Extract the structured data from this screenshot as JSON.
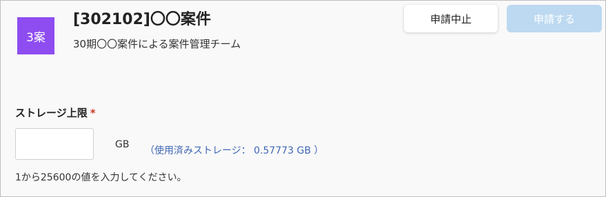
{
  "header": {
    "avatar_text": "3案",
    "avatar_color": "#8e4df0",
    "title": "[302102]〇〇案件",
    "subtitle": "30期〇〇案件による案件管理チーム"
  },
  "actions": {
    "cancel_label": "申請中止",
    "apply_label": "申請する",
    "apply_color": "#bdd9f1"
  },
  "form": {
    "storage_label": "ストレージ上限",
    "required_mark": "*",
    "storage_value": "",
    "unit": "GB",
    "used_storage": "（使用済みストレージ： 0.57773 GB ）",
    "hint": "1から25600の値を入力してください。"
  }
}
